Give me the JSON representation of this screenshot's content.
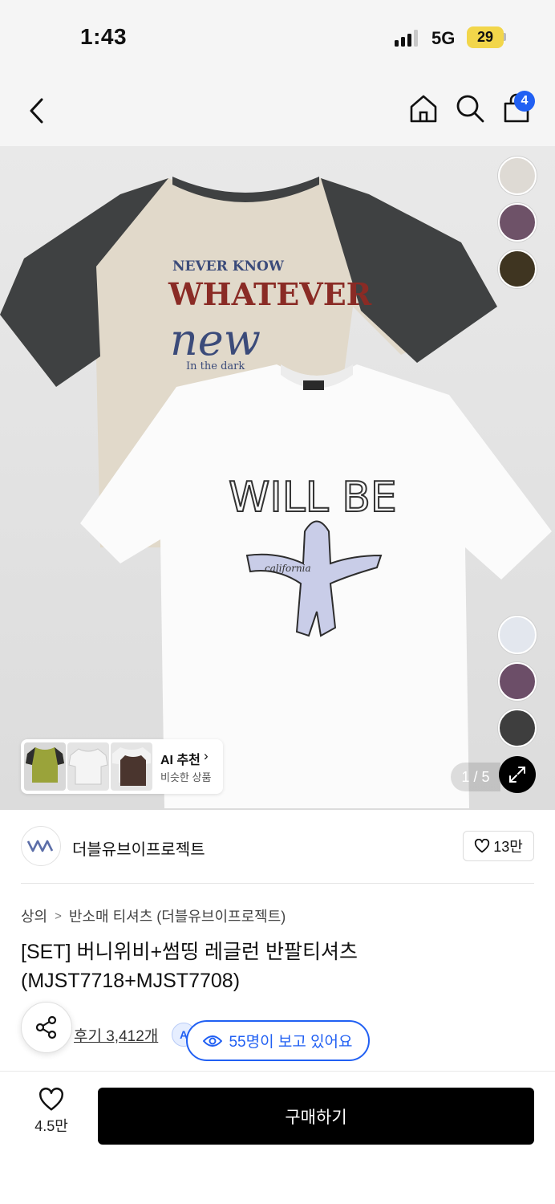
{
  "status_bar": {
    "time": "1:43",
    "network": "5G",
    "battery": "29"
  },
  "nav": {
    "cart_count": "4"
  },
  "gallery": {
    "page_indicator": "1 / 5",
    "top_swatches": [
      "#dedad4",
      "#6e5268",
      "#3f3521"
    ],
    "bottom_swatches": [
      "#e3e7ee",
      "#6c4e68",
      "#3e3e3e"
    ],
    "ai_recommend": {
      "title": "AI 추천",
      "subtitle": "비슷한 상품"
    }
  },
  "brand": {
    "name": "더블유브이프로젝트",
    "likes": "13만"
  },
  "breadcrumb": [
    "상의",
    "반소매 티셔츠 (더블유브이프로젝트)"
  ],
  "product": {
    "title": "[SET] 버니위비+썸띵 레글런 반팔티셔츠 (MJST7718+MJST7708)",
    "reviews": "후기 3,412개",
    "viewers": "55명이 보고 있어요"
  },
  "bottom_bar": {
    "wishlist_count": "4.5만",
    "buy_label": "구매하기"
  },
  "colors": {
    "accent": "#2160f3",
    "buy_button": "#000000"
  }
}
